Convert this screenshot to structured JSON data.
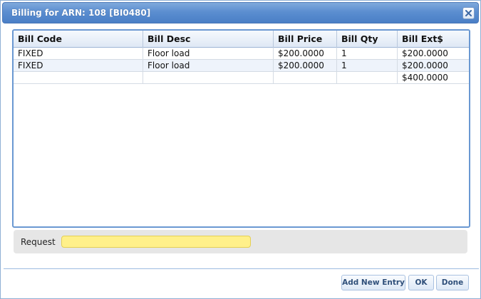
{
  "dialog": {
    "title": "Billing for ARN: 108 [BI0480]"
  },
  "grid": {
    "columns": [
      "Bill Code",
      "Bill Desc",
      "Bill Price",
      "Bill Qty",
      "Bill Ext$"
    ],
    "rows": [
      [
        "FIXED",
        "Floor load",
        "$200.0000",
        "1",
        "$200.0000"
      ],
      [
        "FIXED",
        "Floor load",
        "$200.0000",
        "1",
        "$200.0000"
      ]
    ],
    "total": "$400.0000"
  },
  "request": {
    "label": "Request",
    "value": ""
  },
  "buttons": {
    "add_new_entry": "Add New Entry",
    "ok": "OK",
    "done": "Done"
  },
  "icons": {
    "close": "close-icon"
  }
}
